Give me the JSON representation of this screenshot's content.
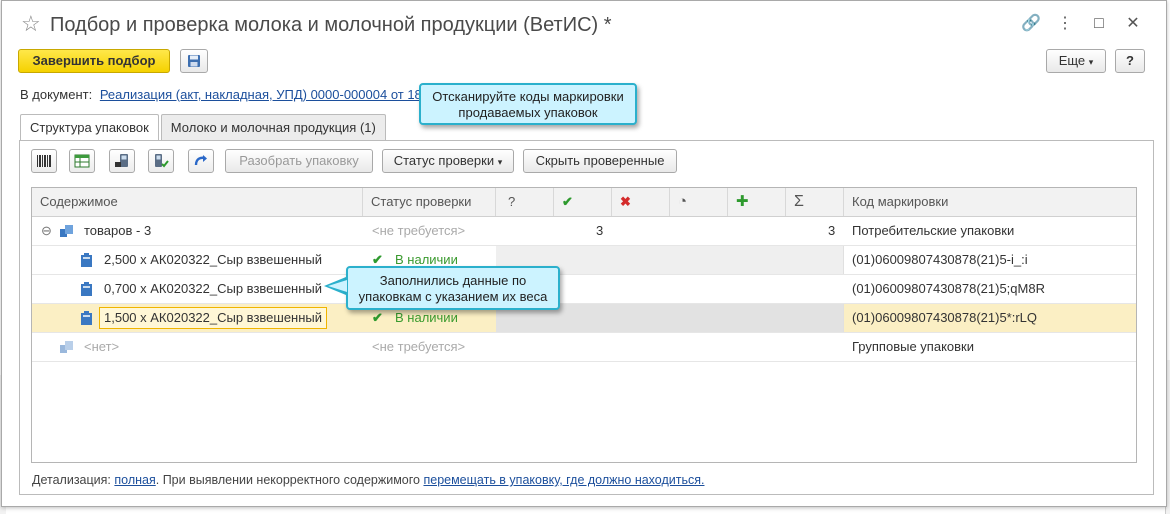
{
  "window": {
    "title": "Подбор и проверка молока и молочной продукции (ВетИС) *",
    "star_icon": "☆",
    "link_icon": "🔗",
    "menu_icon": "⋮",
    "maximize_icon": "□",
    "close_icon": "✕"
  },
  "toolbar": {
    "finish_label": "Завершить подбор",
    "more_label": "Еще",
    "help_label": "?"
  },
  "document": {
    "prefix": "В документ:",
    "link_text": "Реализация (акт, накладная, УПД) 0000-000004 от 18"
  },
  "tooltips": {
    "scan": "Отсканируйте коды маркировки продаваемых упаковок",
    "filled": "Заполнились данные по упаковкам с указанием их веса"
  },
  "tabs": [
    {
      "label": "Структура упаковок"
    },
    {
      "label": "Молоко и молочная продукция (1)"
    }
  ],
  "panel_toolbar": {
    "unpack_label": "Разобрать упаковку",
    "status_label": "Статус проверки",
    "hide_label": "Скрыть проверенные"
  },
  "table": {
    "headers": {
      "content": "Содержимое",
      "status": "Статус проверки",
      "unknown": "?",
      "ok": "✔",
      "bad": "✖",
      "pending": "◔",
      "add": "✚",
      "sum": "Σ",
      "code": "Код маркировки"
    },
    "rows": [
      {
        "content": "товаров - 3",
        "status": "<не требуется>",
        "ok": "3",
        "sum": "3",
        "code": "Потребительские упаковки",
        "expander": "⊖"
      },
      {
        "content": "2,500 x АК020322_Сыр взвешенный",
        "status": "В наличии",
        "code": "(01)06009807430878(21)5-i_:i"
      },
      {
        "content": "0,700 x АК020322_Сыр взвешенный",
        "status": "",
        "code": "(01)06009807430878(21)5;qM8R"
      },
      {
        "content": "1,500 x АК020322_Сыр взвешенный",
        "status": "В наличии",
        "code": "(01)06009807430878(21)5*:rLQ"
      },
      {
        "content": "<нет>",
        "status": "<не требуется>",
        "code": "Групповые упаковки"
      }
    ]
  },
  "footer": {
    "prefix": "Детализация:",
    "detail_link": "полная",
    "middle": ". При выявлении некорректного содержимого",
    "move_link": "перемещать в упаковку, где должно находиться."
  }
}
